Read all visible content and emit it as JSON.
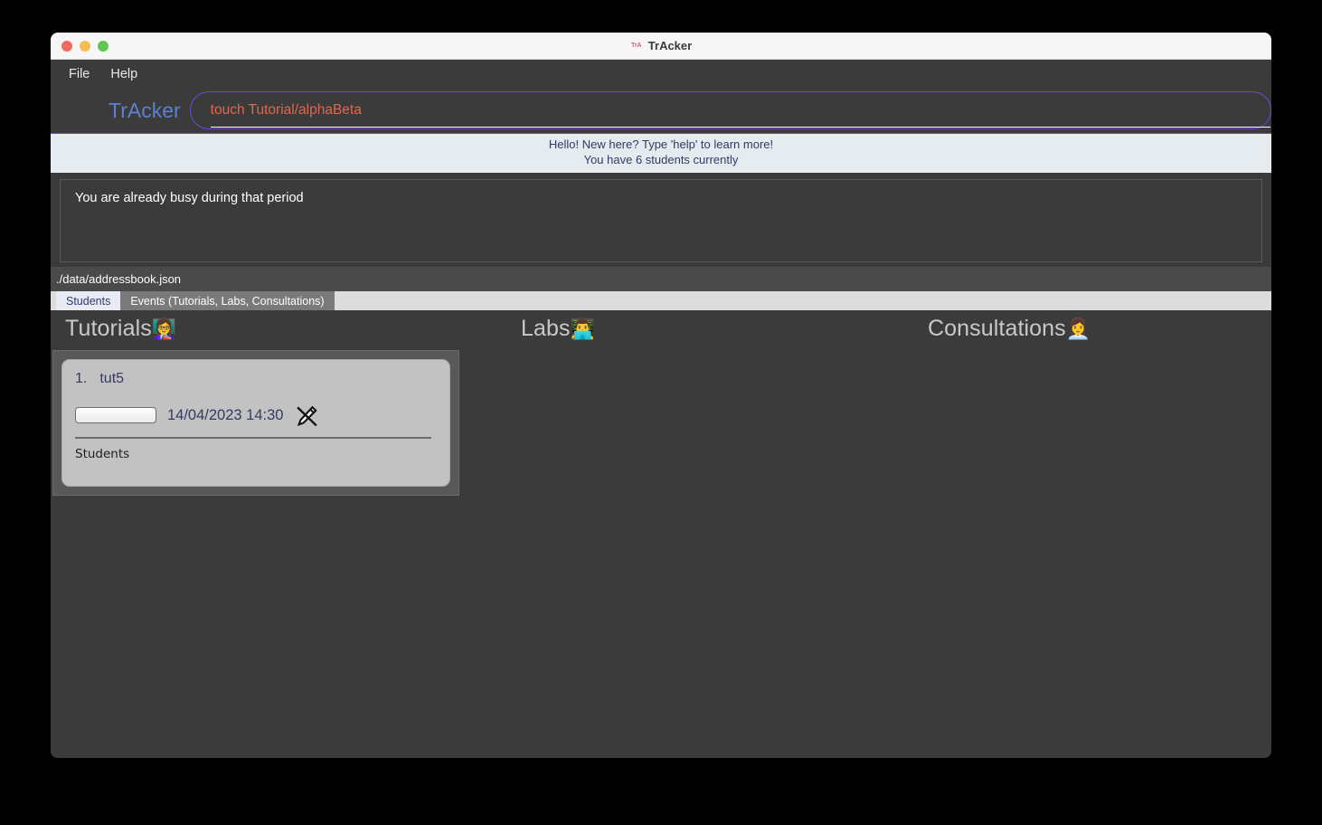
{
  "window": {
    "title": "TrAcker",
    "favicon": "app-icon"
  },
  "menubar": {
    "items": [
      {
        "label": "File"
      },
      {
        "label": "Help"
      }
    ]
  },
  "commandbar": {
    "brand": "TrAcker",
    "input_value": "touch Tutorial/alphaBeta",
    "input_placeholder": "Enter command here...",
    "border_color": "#6f48d8",
    "text_color": "#e0674f"
  },
  "greeting": {
    "line1": "Hello! New here? Type 'help' to learn more!",
    "line2": "You have 6 students currently"
  },
  "result": {
    "message": "You are already busy during that period"
  },
  "path_bar": {
    "path": "./data/addressbook.json"
  },
  "tabs": [
    {
      "label": "Students",
      "active": false
    },
    {
      "label": "Events (Tutorials, Labs, Consultations)",
      "active": true
    }
  ],
  "columns": [
    {
      "id": "tutorials",
      "title": "Tutorials",
      "emoji": "👩‍🏫",
      "emoji_name": "teacher-icon",
      "cards": [
        {
          "index": "1.",
          "name": "tut5",
          "datetime": "14/04/2023 14:30",
          "edit_icon_name": "no-edit-pencil-icon",
          "subhead": "Students"
        }
      ]
    },
    {
      "id": "labs",
      "title": "Labs",
      "emoji": "👨‍💻",
      "emoji_name": "computer-lab-icon",
      "cards": []
    },
    {
      "id": "consultations",
      "title": "Consultations",
      "emoji": "👩‍💼",
      "emoji_name": "consultation-desk-icon",
      "cards": []
    }
  ],
  "colors": {
    "window_bg": "#3b3b3b",
    "accent_purple": "#6f48d8",
    "brand_blue": "#5d82cc",
    "command_text": "#e0674f",
    "banner_bg": "#e6ebef",
    "card_bg": "#c2c2c2",
    "panel_bg": "#595959"
  }
}
